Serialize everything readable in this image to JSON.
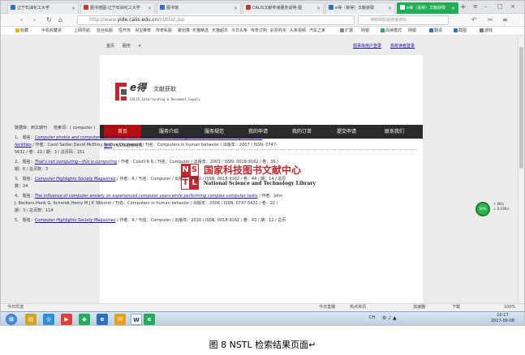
{
  "browser": {
    "tabs": [
      {
        "label": "辽宁石油化工大学",
        "color": "#2d6fc4"
      },
      {
        "label": "图书馆图-辽宁石油化工大学",
        "color": "#c0392b"
      },
      {
        "label": "图书馆",
        "color": "#2d6fc4"
      },
      {
        "label": "CALIS文献传递服务说明-图",
        "color": "#c0392b"
      },
      {
        "label": "e得（易得）文献获取",
        "color": "#2d6fc4"
      },
      {
        "label": "e得（易得）文献获取",
        "color": "#ffffff"
      }
    ],
    "new_tab": "+",
    "url_prefix": "http://www.",
    "url_domain": "yide.calis.edu.cn",
    "url_path": "/nstllist.jsp",
    "search_placeholder": "神眼睛联歌搜播游戏",
    "bookmarks": [
      "收藏",
      "手机收藏夹",
      "上网导航",
      "亚丝私服",
      "恒开传",
      "淘宝推荐",
      "传奇私服",
      "聚划算",
      "天猫精选",
      "天猫超市",
      "今日头条",
      "传奇订购",
      "彩票购买",
      "头条视频",
      "汽车之家"
    ],
    "ext_labels": [
      "扩展",
      "网银",
      "阅读模式",
      "网银",
      "翻译",
      "截图",
      "游戏"
    ]
  },
  "site": {
    "top_links": {
      "home": "首页",
      "service": "服务",
      "login": "题事库用户登录",
      "reader_login": "高校读者登录"
    },
    "logo": {
      "brand": "e得",
      "brand_sub": "文献获取",
      "org": "CALIS Interlending & Document Supply"
    },
    "menu": [
      "首页",
      "服务介绍",
      "服务规范",
      "我的申请",
      "我的订单",
      "提交申请",
      "联系我们"
    ],
    "breadcrumb": {
      "home": "首页",
      "sep": "\\",
      "current": "NSTL检索结果"
    },
    "nstl": {
      "cn": "国家科技图书文献中心",
      "en": "National Science and Technology Library",
      "n": "N",
      "s": "S",
      "t": "T",
      "l": "L"
    }
  },
  "search_info": {
    "db_label": "数据库：",
    "db": "西文期刊",
    "kw_label": "检索词：",
    "kw": "( computer )"
  },
  "results": [
    {
      "num": "1、",
      "lbl": "题名：",
      "title1": "Computer phobia and computer self-efficacy: their association with undergraduates' use of university computer",
      "title2": "facilities",
      "meta1": "/ 作者：Carol Sadler,David McElroy,Nadine Doujanovd / 刊名：Computers in human behavior / 出版年：2007 / ISSN: 0747-",
      "meta2": "5632 / 卷：23 / 期：3 / 总页码：151"
    },
    {
      "num": "2、",
      "lbl": "题名：",
      "title1": "That's not computing—this is computing",
      "meta1": "/ 作者：Colvill R R / 刊名：Computer / 出版年：2003 / ISSN: 0018-9162 / 卷：36 /",
      "meta2": "期：6 / 总页数：3"
    },
    {
      "num": "3、",
      "lbl": "题名：",
      "title1": "Computer Highlights Society Magazines",
      "meta1": "/ 作者：R / 刊名：Computer / 出版年：2011 / ISSN: 0018-9162 / 卷：44 / 期：14 / 总页",
      "meta2": "数：24"
    },
    {
      "num": "4、",
      "lbl": "题名：",
      "title1": "The influence of computer anxiety on experienced computer users while performing complex computer tasks",
      "meta1": "/ 作者：John",
      "meta2": "J. Beckers,Henk G. Schmidt,Hemy M J.P. Wiborst / 刊名：Computers in human behavior / 出版年：2008 / ISSN: 0747-5632 / 卷：22 /",
      "meta3": "期：3 / 总页数：114"
    },
    {
      "num": "5、",
      "lbl": "题名：",
      "title1": "Computer Highlights Society Magazines",
      "meta1": "/ 作者：R / 刊名：Computer / 出版年：2010 / ISSN: 0018-9162 / 卷：43 / 期：12 / 总页"
    }
  ],
  "floater": {
    "percent": "56%",
    "up": "0K/s",
    "down": "0.03K/s"
  },
  "statusbar": {
    "left": "今日优选",
    "items": [
      "今日直播",
      "热点资讯",
      "加速器",
      "下载"
    ],
    "zoom": "100%"
  },
  "taskbar": {
    "apps": [
      "e",
      "W",
      "e"
    ],
    "time": "10:17",
    "date": "2017-09-08",
    "lang": "CH"
  },
  "caption": "图 8    NSTL 检索结果页面↵",
  "colors": {
    "accent": "#1fae56",
    "menu_bg": "#2b2b2b",
    "menu_active": "#b40f0f",
    "link": "#1a0dab",
    "nstl_red": "#c2262e"
  }
}
